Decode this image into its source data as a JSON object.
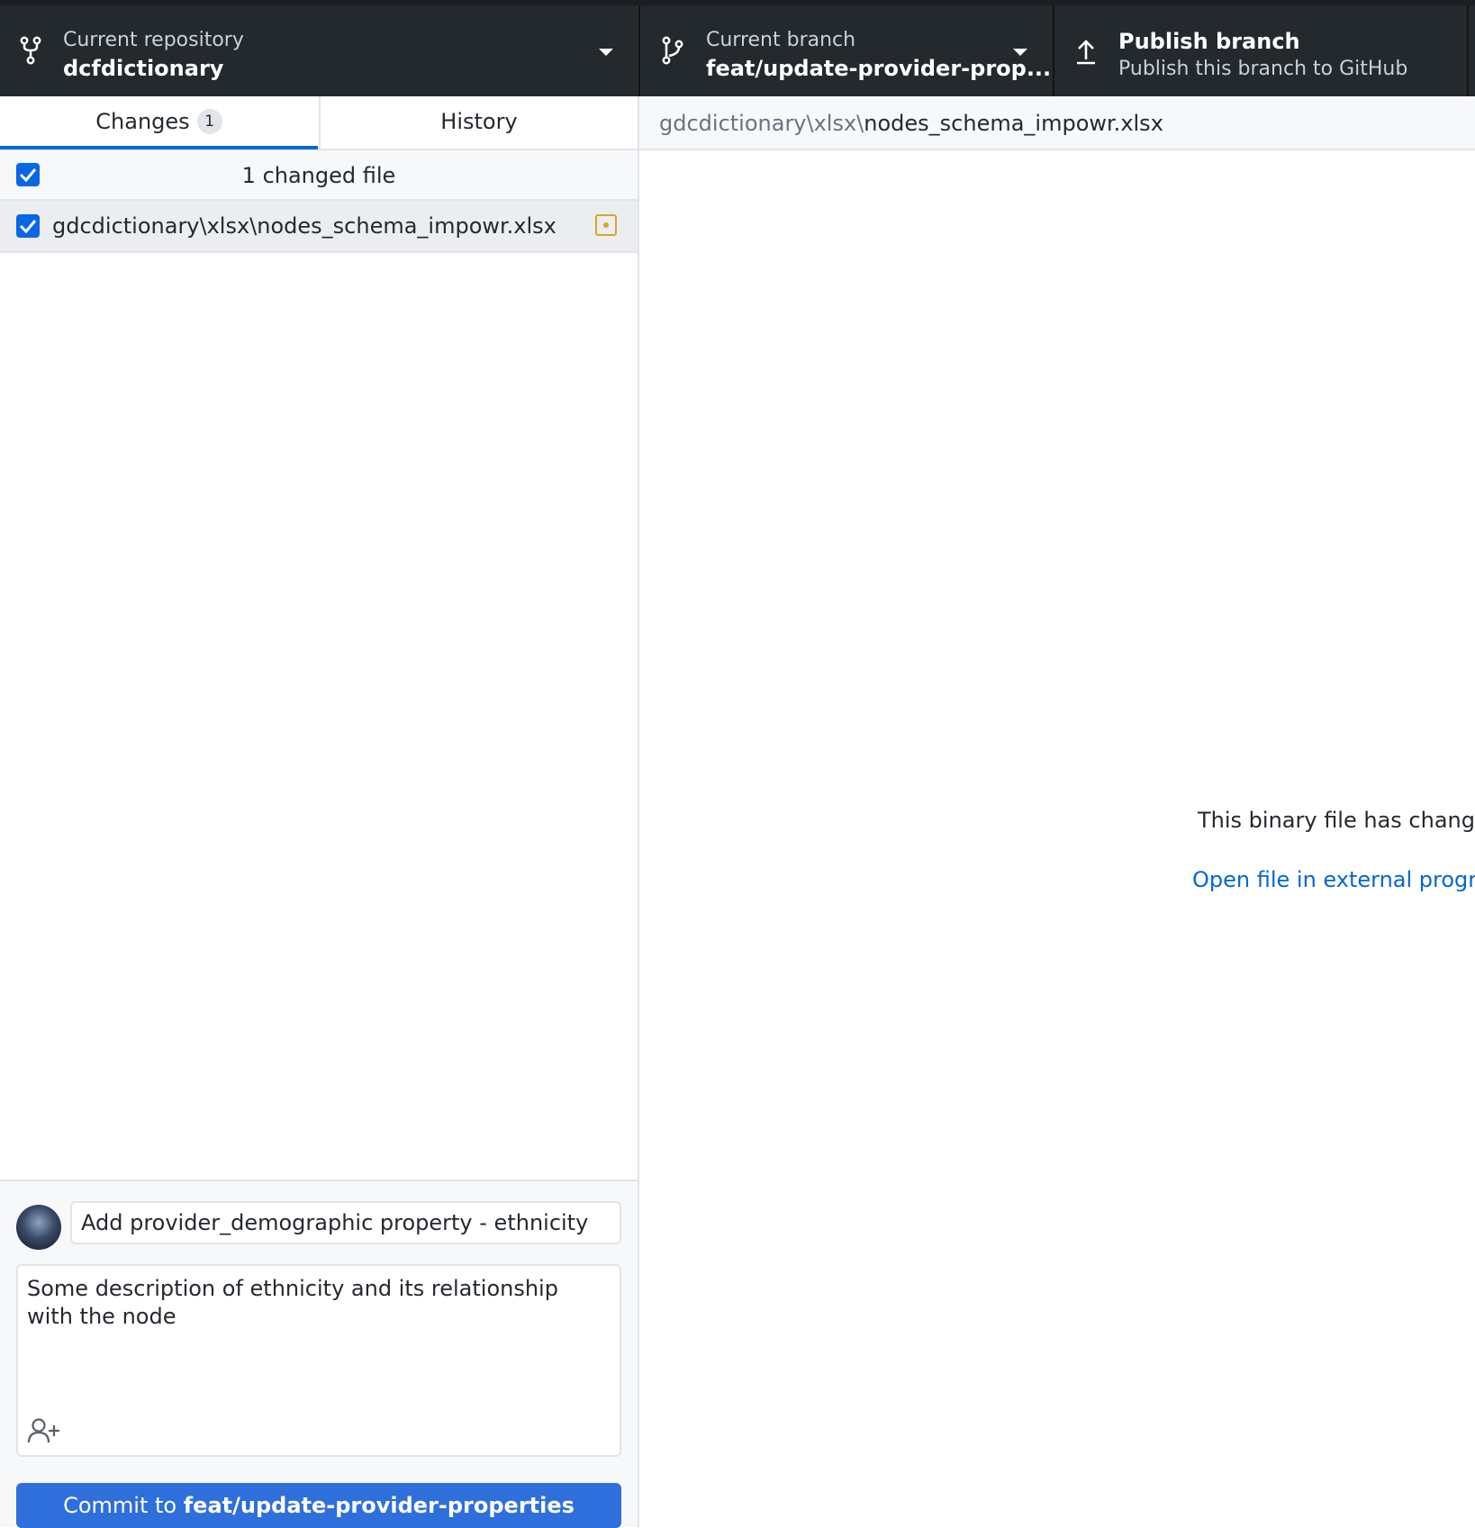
{
  "toolbar": {
    "repository": {
      "title": "Current repository",
      "value": "dcfdictionary",
      "icon": "repo-icon"
    },
    "branch": {
      "title": "Current branch",
      "value": "feat/update-provider-prop...",
      "icon": "branch-icon"
    },
    "publish": {
      "title": "Publish branch",
      "subtitle": "Publish this branch to GitHub",
      "icon": "upload-icon"
    }
  },
  "tabs": {
    "changes": {
      "label": "Changes",
      "count": "1"
    },
    "history": {
      "label": "History"
    }
  },
  "changes": {
    "summary": "1 changed file",
    "files": [
      {
        "path": "gdcdictionary\\xlsx\\nodes_schema_impowr.xlsx",
        "status": "modified"
      }
    ]
  },
  "commit": {
    "summary_value": "Add provider_demographic property - ethnicity",
    "description": "Some description of ethnicity and its relationship with the node",
    "button_prefix": "Commit to ",
    "button_branch": "feat/update-provider-properties"
  },
  "diff": {
    "path_dir": "gdcdictionary\\xlsx\\",
    "path_file": "nodes_schema_impowr.xlsx",
    "message": "This binary file has changed.",
    "open_link": "Open file in external program."
  },
  "colors": {
    "toolbar_bg": "#24292e",
    "accent": "#0366d6",
    "commit_button": "#2f6fdb",
    "modified": "#d4a72c"
  }
}
